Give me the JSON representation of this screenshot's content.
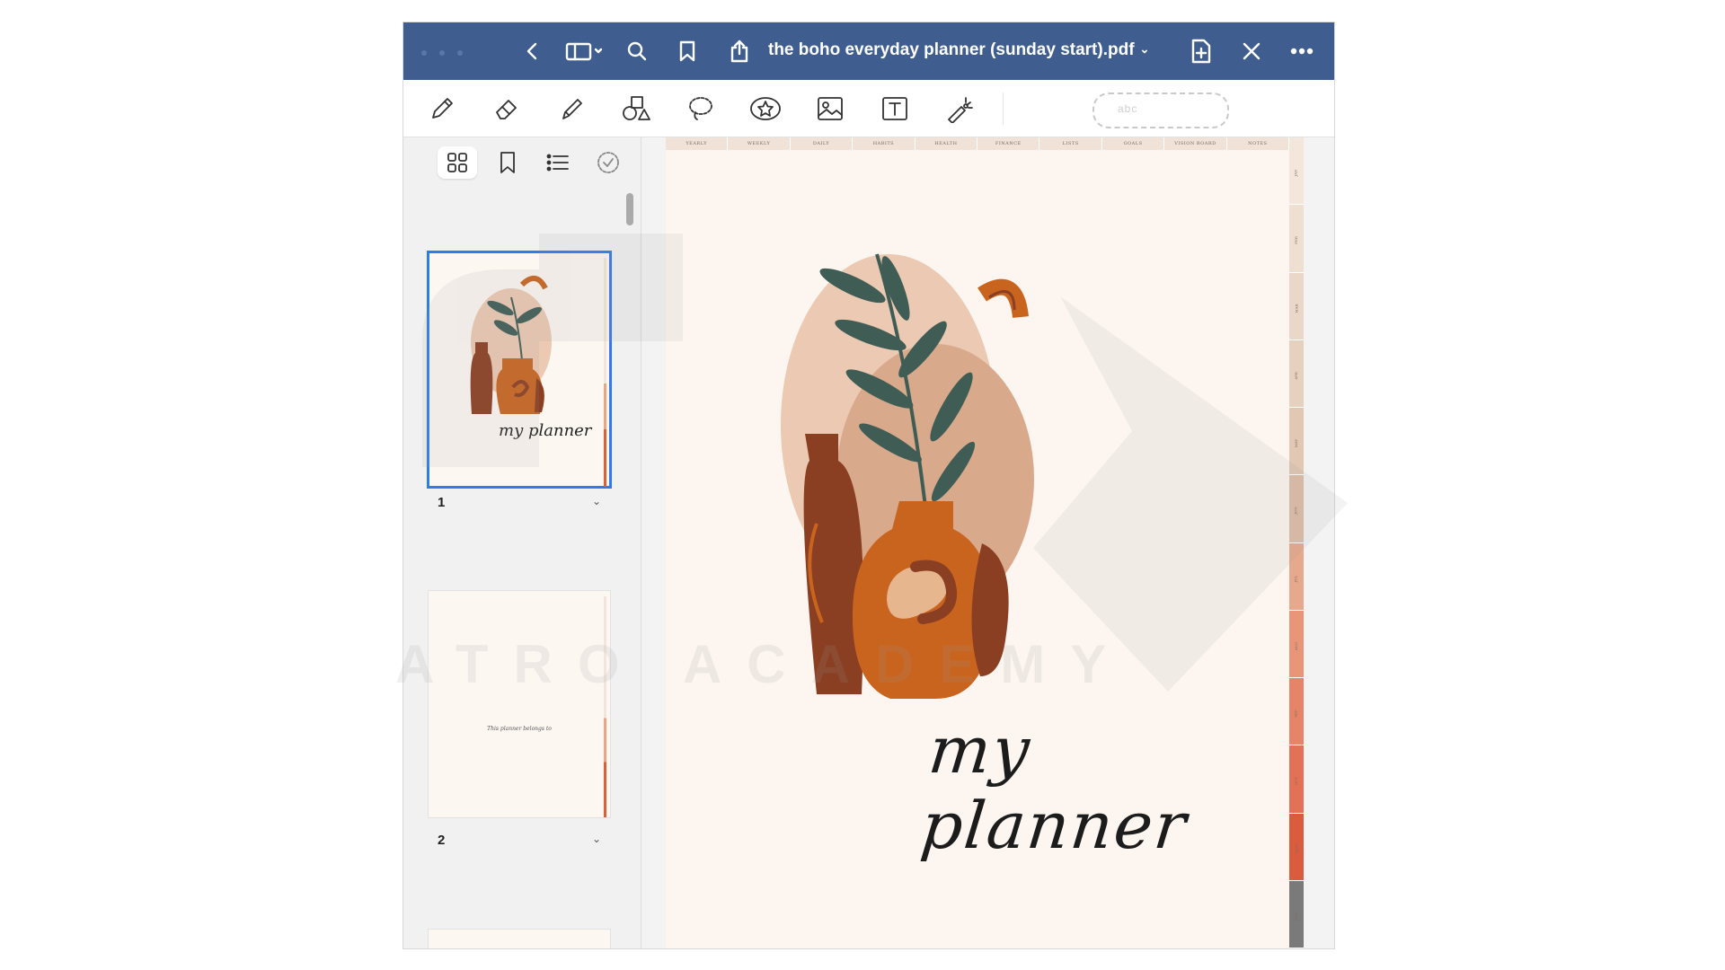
{
  "window": {
    "title": "the boho everyday planner (sunday start).pdf"
  },
  "titlebar_icons": [
    "back-icon",
    "sidebar-toggle-icon",
    "search-icon",
    "bookmark-icon",
    "share-icon",
    "add-page-icon",
    "close-icon",
    "more-icon"
  ],
  "toolbar": {
    "tools": [
      "pen-icon",
      "eraser-icon",
      "highlighter-icon",
      "shapes-icon",
      "lasso-icon",
      "sticker-icon",
      "image-icon",
      "text-icon",
      "laser-pointer-icon"
    ],
    "selection_pill_text": "abc"
  },
  "sidebar": {
    "tabs": [
      "thumbnails-icon",
      "bookmarks-icon",
      "outline-icon",
      "checkmark-icon"
    ],
    "pages": [
      {
        "number": "1",
        "thumb_caption": "my planner"
      },
      {
        "number": "2",
        "thumb_caption": "This planner belongs to"
      }
    ]
  },
  "page": {
    "top_tabs": [
      "YEARLY",
      "WEEKLY",
      "DAILY",
      "HABITS",
      "HEALTH",
      "FINANCE",
      "LISTS",
      "GOALS",
      "VISION BOARD",
      "NOTES"
    ],
    "side_tabs": [
      "JAN",
      "FEB",
      "MAR",
      "APR",
      "MAY",
      "JUN",
      "JUL",
      "AUG",
      "SEP",
      "OCT",
      "NOV",
      "DEC"
    ],
    "script_title": "my planner"
  },
  "watermark": {
    "text": "ATRO ACADEMY"
  },
  "colors": {
    "titlebar": "#3f5e8f",
    "selected_outline": "#2f7bea",
    "page_bg": "#fdf6f0",
    "terracotta": "#c9641f",
    "clay_dark": "#8a3e22",
    "leaf": "#3f5d55",
    "blush": "#ecc9b2"
  }
}
